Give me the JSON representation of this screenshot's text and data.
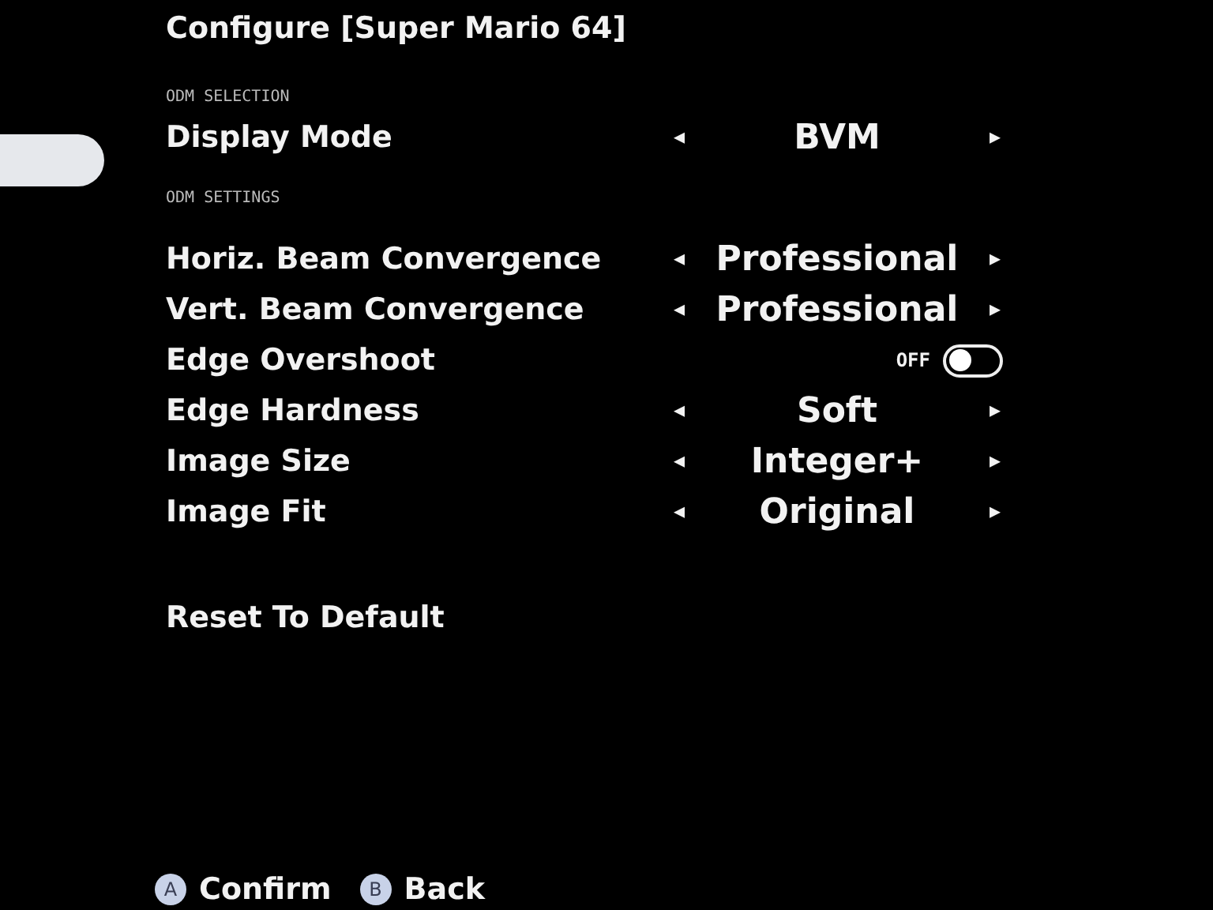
{
  "title": "Configure [Super Mario 64]",
  "sections": [
    {
      "heading": "ODM SELECTION",
      "rows": [
        {
          "kind": "selector",
          "label": "Display Mode",
          "value": "BVM",
          "left": "◂",
          "right": "▸"
        }
      ]
    },
    {
      "heading": "ODM SETTINGS",
      "rows": [
        {
          "kind": "selector",
          "label": "Horiz. Beam Convergence",
          "value": "Professional",
          "left": "◂",
          "right": "▸"
        },
        {
          "kind": "selector",
          "label": "Vert. Beam Convergence",
          "value": "Professional",
          "left": "◂",
          "right": "▸"
        },
        {
          "kind": "toggle",
          "label": "Edge Overshoot",
          "state_text": "OFF",
          "on": false
        },
        {
          "kind": "selector",
          "label": "Edge Hardness",
          "value": "Soft",
          "left": "◂",
          "right": "▸"
        },
        {
          "kind": "selector",
          "label": "Image Size",
          "value": "Integer+",
          "left": "◂",
          "right": "▸"
        },
        {
          "kind": "selector",
          "label": "Image Fit",
          "value": "Original",
          "left": "◂",
          "right": "▸"
        }
      ]
    }
  ],
  "reset": "Reset To Default",
  "footer": [
    {
      "key": "A",
      "label": "Confirm"
    },
    {
      "key": "B",
      "label": "Back"
    }
  ]
}
